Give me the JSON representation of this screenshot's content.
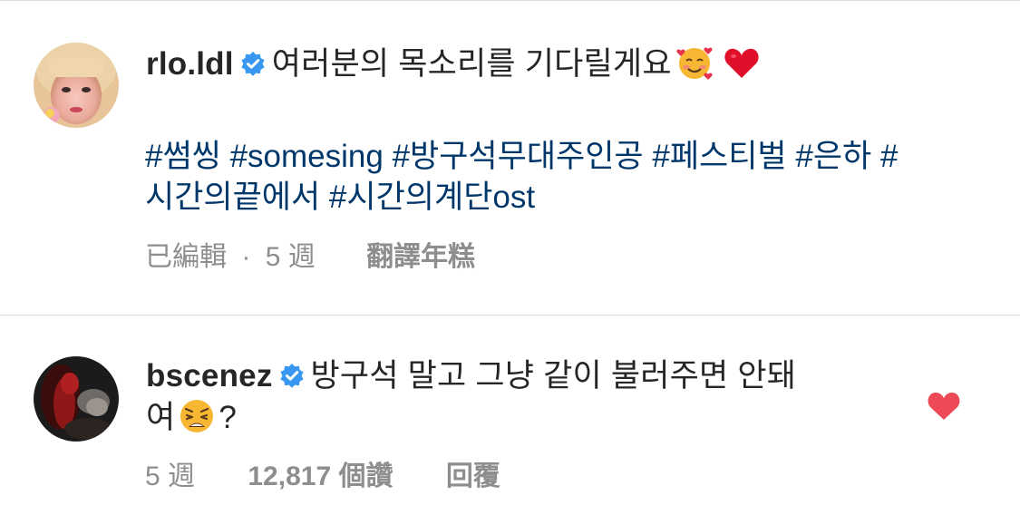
{
  "comments": [
    {
      "username": "rlo.ldl",
      "verified": true,
      "text": "여러분의 목소리를 기다릴게요",
      "emojis": [
        "smiling-face-with-hearts",
        "red-heart"
      ],
      "hashtags_line1": "#썸씽 #somesing #방구석무대주인공 #페스티벌 #은하 #",
      "hashtags_line2": "시간의끝에서 #시간의계단ost",
      "meta": {
        "edited": "已編輯",
        "separator": "·",
        "age": "5 週",
        "action": "翻譯年糕"
      }
    },
    {
      "username": "bscenez",
      "verified": true,
      "text_line1": "방구석 말고 그냥 같이 불러주면 안돼",
      "text_line2_prefix": "여",
      "text_line2_suffix": "?",
      "emojis": [
        "weary-face"
      ],
      "liked": true,
      "meta": {
        "age": "5 週",
        "likes": "12,817 個讚",
        "reply": "回覆"
      }
    }
  ],
  "colors": {
    "text": "#262626",
    "hashtag": "#00376b",
    "meta": "#8e8e8e",
    "verified": "#3897f0",
    "like_heart": "#ed4956",
    "divider": "#dbdbdb"
  }
}
